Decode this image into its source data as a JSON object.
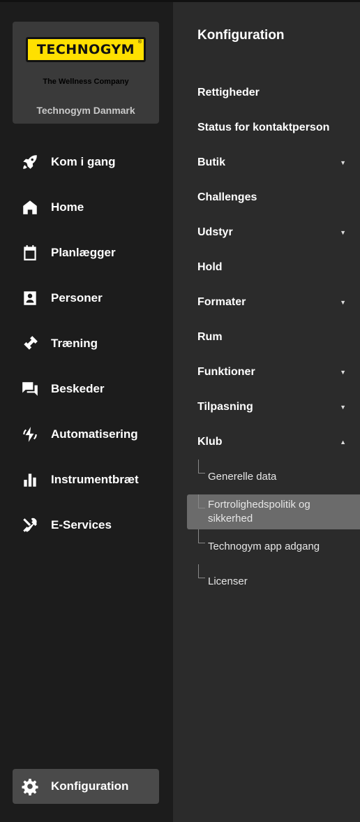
{
  "brand": {
    "logo_text": "TECHNOGYM",
    "tagline": "The Wellness Company",
    "company": "Technogym Danmark"
  },
  "nav": {
    "items": [
      {
        "label": "Kom i gang",
        "icon": "rocket-icon"
      },
      {
        "label": "Home",
        "icon": "home-icon"
      },
      {
        "label": "Planlægger",
        "icon": "calendar-icon"
      },
      {
        "label": "Personer",
        "icon": "person-badge-icon"
      },
      {
        "label": "Træning",
        "icon": "dumbbell-icon"
      },
      {
        "label": "Beskeder",
        "icon": "chat-icon"
      },
      {
        "label": "Automatisering",
        "icon": "automation-icon"
      },
      {
        "label": "Instrumentbræt",
        "icon": "bar-chart-icon"
      },
      {
        "label": "E-Services",
        "icon": "tools-icon"
      }
    ],
    "config": {
      "label": "Konfiguration",
      "icon": "gear-icon"
    }
  },
  "panel": {
    "title": "Konfiguration",
    "items": [
      {
        "label": "Rettigheder",
        "expandable": false
      },
      {
        "label": "Status for kontaktperson",
        "expandable": false
      },
      {
        "label": "Butik",
        "expandable": true,
        "caret": "▼"
      },
      {
        "label": "Challenges",
        "expandable": false
      },
      {
        "label": "Udstyr",
        "expandable": true,
        "caret": "▼"
      },
      {
        "label": "Hold",
        "expandable": false
      },
      {
        "label": "Formater",
        "expandable": true,
        "caret": "▼"
      },
      {
        "label": "Rum",
        "expandable": false
      },
      {
        "label": "Funktioner",
        "expandable": true,
        "caret": "▼"
      },
      {
        "label": "Tilpasning",
        "expandable": true,
        "caret": "▼"
      },
      {
        "label": "Klub",
        "expandable": true,
        "caret": "▲"
      }
    ],
    "sub_items": [
      {
        "label": "Generelle data"
      },
      {
        "label": "Fortrolighedspolitik og sikkerhed",
        "active": true
      },
      {
        "label": "Technogym app adgang"
      },
      {
        "label": "Licenser"
      }
    ]
  }
}
